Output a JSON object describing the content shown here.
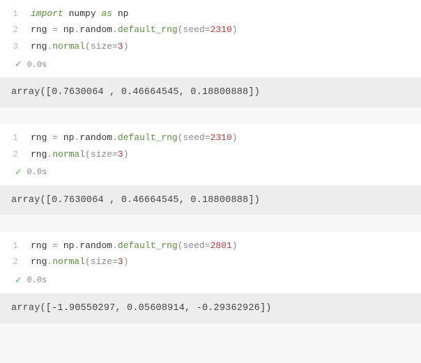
{
  "cells": [
    {
      "lines": [
        {
          "n": "1",
          "tokens": [
            {
              "t": "import",
              "c": "tok-kw-import"
            },
            {
              "t": " ",
              "c": ""
            },
            {
              "t": "numpy",
              "c": "tok-name"
            },
            {
              "t": " ",
              "c": ""
            },
            {
              "t": "as",
              "c": "tok-kw-as"
            },
            {
              "t": " ",
              "c": ""
            },
            {
              "t": "np",
              "c": "tok-name"
            }
          ]
        },
        {
          "n": "2",
          "tokens": [
            {
              "t": "rng ",
              "c": "tok-name"
            },
            {
              "t": "=",
              "c": "tok-eq"
            },
            {
              "t": " ",
              "c": ""
            },
            {
              "t": "np",
              "c": "tok-name"
            },
            {
              "t": ".",
              "c": "tok-dot"
            },
            {
              "t": "random",
              "c": "tok-name"
            },
            {
              "t": ".",
              "c": "tok-dot"
            },
            {
              "t": "default_rng",
              "c": "tok-func"
            },
            {
              "t": "(",
              "c": "tok-paren"
            },
            {
              "t": "seed",
              "c": "tok-param"
            },
            {
              "t": "=",
              "c": "tok-eq"
            },
            {
              "t": "2310",
              "c": "tok-num"
            },
            {
              "t": ")",
              "c": "tok-paren"
            }
          ]
        },
        {
          "n": "3",
          "tokens": [
            {
              "t": "rng",
              "c": "tok-name"
            },
            {
              "t": ".",
              "c": "tok-dot"
            },
            {
              "t": "normal",
              "c": "tok-func"
            },
            {
              "t": "(",
              "c": "tok-paren"
            },
            {
              "t": "size",
              "c": "tok-param"
            },
            {
              "t": "=",
              "c": "tok-eq"
            },
            {
              "t": "3",
              "c": "tok-num"
            },
            {
              "t": ")",
              "c": "tok-paren"
            }
          ]
        }
      ],
      "status_time": "0.0s",
      "output": "array([0.7630064 , 0.46664545, 0.18800888])"
    },
    {
      "lines": [
        {
          "n": "1",
          "tokens": [
            {
              "t": "rng ",
              "c": "tok-name"
            },
            {
              "t": "=",
              "c": "tok-eq"
            },
            {
              "t": " ",
              "c": ""
            },
            {
              "t": "np",
              "c": "tok-name"
            },
            {
              "t": ".",
              "c": "tok-dot"
            },
            {
              "t": "random",
              "c": "tok-name"
            },
            {
              "t": ".",
              "c": "tok-dot"
            },
            {
              "t": "default_rng",
              "c": "tok-func"
            },
            {
              "t": "(",
              "c": "tok-paren"
            },
            {
              "t": "seed",
              "c": "tok-param"
            },
            {
              "t": "=",
              "c": "tok-eq"
            },
            {
              "t": "2310",
              "c": "tok-num"
            },
            {
              "t": ")",
              "c": "tok-paren"
            }
          ]
        },
        {
          "n": "2",
          "tokens": [
            {
              "t": "rng",
              "c": "tok-name"
            },
            {
              "t": ".",
              "c": "tok-dot"
            },
            {
              "t": "normal",
              "c": "tok-func"
            },
            {
              "t": "(",
              "c": "tok-paren"
            },
            {
              "t": "size",
              "c": "tok-param"
            },
            {
              "t": "=",
              "c": "tok-eq"
            },
            {
              "t": "3",
              "c": "tok-num"
            },
            {
              "t": ")",
              "c": "tok-paren"
            }
          ]
        }
      ],
      "status_time": "0.0s",
      "output": "array([0.7630064 , 0.46664545, 0.18800888])"
    },
    {
      "lines": [
        {
          "n": "1",
          "tokens": [
            {
              "t": "rng ",
              "c": "tok-name"
            },
            {
              "t": "=",
              "c": "tok-eq"
            },
            {
              "t": " ",
              "c": ""
            },
            {
              "t": "np",
              "c": "tok-name"
            },
            {
              "t": ".",
              "c": "tok-dot"
            },
            {
              "t": "random",
              "c": "tok-name"
            },
            {
              "t": ".",
              "c": "tok-dot"
            },
            {
              "t": "default_rng",
              "c": "tok-func"
            },
            {
              "t": "(",
              "c": "tok-paren"
            },
            {
              "t": "seed",
              "c": "tok-param"
            },
            {
              "t": "=",
              "c": "tok-eq"
            },
            {
              "t": "2801",
              "c": "tok-num"
            },
            {
              "t": ")",
              "c": "tok-paren"
            }
          ]
        },
        {
          "n": "2",
          "tokens": [
            {
              "t": "rng",
              "c": "tok-name"
            },
            {
              "t": ".",
              "c": "tok-dot"
            },
            {
              "t": "normal",
              "c": "tok-func"
            },
            {
              "t": "(",
              "c": "tok-paren"
            },
            {
              "t": "size",
              "c": "tok-param"
            },
            {
              "t": "=",
              "c": "tok-eq"
            },
            {
              "t": "3",
              "c": "tok-num"
            },
            {
              "t": ")",
              "c": "tok-paren"
            }
          ]
        }
      ],
      "status_time": "0.0s",
      "output": "array([-1.90550297,  0.05608914, -0.29362926])"
    }
  ],
  "check_glyph": "✓"
}
